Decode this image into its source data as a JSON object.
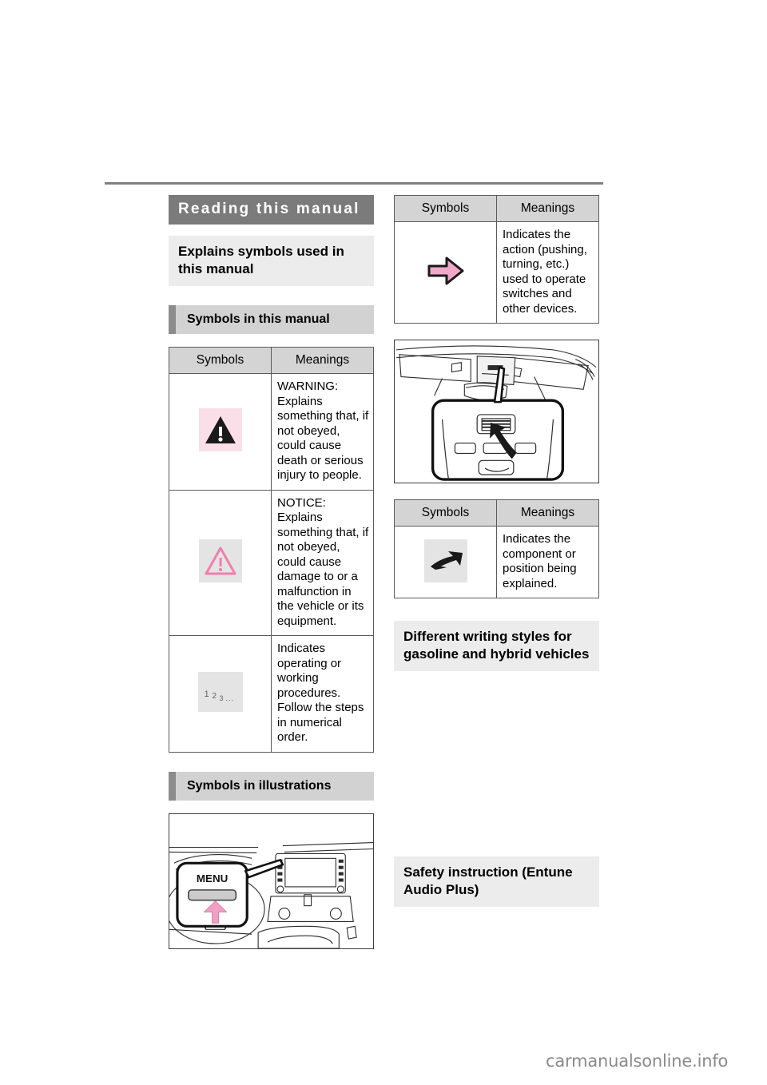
{
  "document": {
    "watermark": "carmanualsonline.info"
  },
  "left_column": {
    "chapter_title": "Reading this manual",
    "section_heading": "Explains symbols used in this manual",
    "sub_heading_symbols_manual": "Symbols in this manual",
    "sub_heading_symbols_illustrations": "Symbols in illustrations",
    "table": {
      "headers": [
        "Symbols",
        "Meanings"
      ],
      "rows": [
        {
          "icon": "warning-triangle-icon",
          "icon_bg": "#fadfe8",
          "meaning": "WARNING:\nExplains something that, if not obeyed, could cause death or serious injury to people."
        },
        {
          "icon": "notice-triangle-icon",
          "icon_bg": "#e4e4e4",
          "meaning": "NOTICE:\nExplains something that, if not obeyed, could cause damage to or a malfunction in the vehicle or its equipment."
        },
        {
          "icon": "numbered-steps-icon",
          "icon_bg": "#e4e4e4",
          "icon_text": "1 2 3...",
          "meaning": "Indicates operating or working procedures. Follow the steps in numerical order."
        }
      ]
    },
    "illustration": {
      "name": "dashboard-menu-button-illustration",
      "callout_label": "MENU"
    }
  },
  "right_column": {
    "table_action": {
      "headers": [
        "Symbols",
        "Meanings"
      ],
      "rows": [
        {
          "icon": "pink-block-arrow-icon",
          "meaning": "Indicates the action (pushing, turning, etc.) used to operate switches and other devices."
        }
      ]
    },
    "illustration": {
      "name": "overhead-console-illustration"
    },
    "table_component": {
      "headers": [
        "Symbols",
        "Meanings"
      ],
      "rows": [
        {
          "icon": "black-swoosh-arrow-icon",
          "icon_bg": "#e4e4e4",
          "meaning": "Indicates the component or position being explained."
        }
      ]
    },
    "section_heading_writing_styles": "Different writing styles for gasoline and hybrid vehicles",
    "section_heading_safety": "Safety instruction (Entune Audio Plus)"
  },
  "colors": {
    "chapter_bar": "#7b7b7b",
    "section_block": "#ececec",
    "sub_head_block": "#d2d2d2",
    "sub_head_tab": "#8c8c8c",
    "table_header": "#d4d4d4",
    "pink_accent": "#f0a8c4",
    "pink_light": "#fadfe8",
    "rule": "#808080"
  }
}
